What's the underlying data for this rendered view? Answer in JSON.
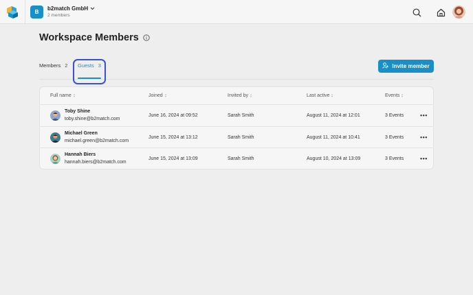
{
  "topbar": {
    "org_initial": "B",
    "org_name": "b2match GmbH",
    "org_members": "2 members"
  },
  "page": {
    "title": "Workspace Members"
  },
  "tabs": [
    {
      "label": "Members",
      "count": "2"
    },
    {
      "label": "Guests",
      "count": "3",
      "active": true
    }
  ],
  "invite_button": {
    "label": "Invite member"
  },
  "table": {
    "columns": [
      "Full name",
      "Joined",
      "Invited by",
      "Last active",
      "Events"
    ],
    "rows": [
      {
        "name": "Toby Shine",
        "email": "toby.shine@b2match.com",
        "joined": "June 16, 2024 at 09:52",
        "invited_by": "Sarah Smith",
        "last_active": "August 11, 2024 at 12:01",
        "events": "3 Events"
      },
      {
        "name": "Michael Green",
        "email": "michael.green@b2match.com",
        "joined": "June 15, 2024 at 13:12",
        "invited_by": "Sarah Smith",
        "last_active": "August 11, 2024 at 10:41",
        "events": "3 Events"
      },
      {
        "name": "Hannah Biers",
        "email": "hannah.biers@b2match.com",
        "joined": "June 15, 2024 at 13:09",
        "invited_by": "Sarah Smith",
        "last_active": "August 10, 2024 at 13:09",
        "events": "3 Events"
      }
    ]
  },
  "icons": {
    "logo": "b2match-logo-icon",
    "org_dropdown": "chevron-down-icon",
    "search": "search-icon",
    "home": "home-icon",
    "info": "info-icon",
    "invite": "add-user-icon",
    "sort": "sort-icon",
    "row_menu": "more-horizontal-icon"
  },
  "colors": {
    "accent": "#1a8fc7",
    "focus_ring": "#3b4fd6"
  }
}
